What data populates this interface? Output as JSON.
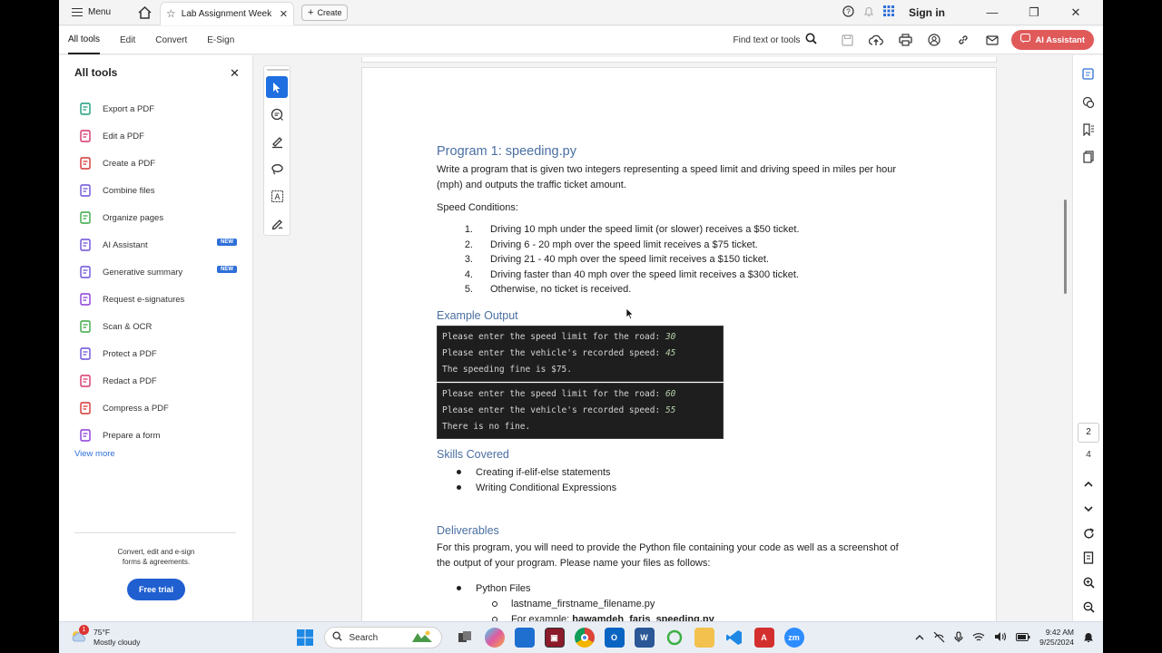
{
  "titlebar": {
    "menu_label": "Menu",
    "tab_title": "Lab Assignment Week 0...",
    "create_label": "Create",
    "sign_in": "Sign in"
  },
  "toolbar": {
    "nav": [
      "All tools",
      "Edit",
      "Convert",
      "E-Sign"
    ],
    "find_label": "Find text or tools",
    "ai_assistant": "AI Assistant"
  },
  "left_panel": {
    "title": "All tools",
    "items": [
      {
        "label": "Export a PDF",
        "icon": "export-pdf-icon",
        "color": "#1a9c7b"
      },
      {
        "label": "Edit a PDF",
        "icon": "edit-pdf-icon",
        "color": "#d6336c"
      },
      {
        "label": "Create a PDF",
        "icon": "create-pdf-icon",
        "color": "#d63333"
      },
      {
        "label": "Combine files",
        "icon": "combine-files-icon",
        "color": "#6b4fd8"
      },
      {
        "label": "Organize pages",
        "icon": "organize-pages-icon",
        "color": "#39a845"
      },
      {
        "label": "AI Assistant",
        "icon": "ai-assistant-icon",
        "color": "#6b4fd8",
        "badge": "NEW"
      },
      {
        "label": "Generative summary",
        "icon": "generative-summary-icon",
        "color": "#6b4fd8",
        "badge": "NEW"
      },
      {
        "label": "Request e-signatures",
        "icon": "request-esignatures-icon",
        "color": "#8a3ad8"
      },
      {
        "label": "Scan & OCR",
        "icon": "scan-ocr-icon",
        "color": "#39a845"
      },
      {
        "label": "Protect a PDF",
        "icon": "protect-pdf-icon",
        "color": "#6b4fd8"
      },
      {
        "label": "Redact a PDF",
        "icon": "redact-pdf-icon",
        "color": "#d6336c"
      },
      {
        "label": "Compress a PDF",
        "icon": "compress-pdf-icon",
        "color": "#d63333"
      },
      {
        "label": "Prepare a form",
        "icon": "prepare-form-icon",
        "color": "#8a3ad8"
      }
    ],
    "view_more": "View more",
    "promo_line1": "Convert, edit and e-sign",
    "promo_line2": "forms & agreements.",
    "free_trial": "Free trial"
  },
  "document": {
    "program_title": "Program 1: speeding.py",
    "intro_line1": "Write a program that is given two integers representing a speed limit and driving speed in miles per hour",
    "intro_line2": "(mph) and outputs the traffic ticket amount.",
    "conditions_label": "Speed Conditions:",
    "conditions": [
      {
        "num": "1.",
        "text": "Driving 10 mph under the speed limit (or slower) receives a $50 ticket."
      },
      {
        "num": "2.",
        "text": "Driving 6 - 20 mph over the speed limit receives a $75 ticket."
      },
      {
        "num": "3.",
        "text": "Driving 21 - 40 mph over the speed limit receives a $150 ticket."
      },
      {
        "num": "4.",
        "text": "Driving faster than 40 mph over the speed limit receives a $300 ticket."
      },
      {
        "num": "5.",
        "text": "Otherwise, no ticket is received."
      }
    ],
    "example_heading": "Example Output",
    "example1": [
      {
        "text": "Please enter the speed limit for the road: ",
        "val": "30"
      },
      {
        "text": "Please enter the vehicle's recorded speed: ",
        "val": "45"
      },
      {
        "text": "The speeding fine is $75.",
        "val": ""
      }
    ],
    "example2": [
      {
        "text": "Please enter the speed limit for the road: ",
        "val": "60"
      },
      {
        "text": "Please enter the vehicle's recorded speed: ",
        "val": "55"
      },
      {
        "text": "There is no fine.",
        "val": ""
      }
    ],
    "skills_heading": "Skills Covered",
    "skills": [
      "Creating if-elif-else statements",
      "Writing Conditional Expressions"
    ],
    "deliverables_heading": "Deliverables",
    "deliverables_line1": "For this program, you will need to provide the Python file containing your code as well as a screenshot of",
    "deliverables_line2": "the output of your program. Please name your files as follows:",
    "python_files": "Python Files",
    "file_pattern": "lastname_firstname_filename.py",
    "example_prefix": "For example: ",
    "example_file": "hawamdeh_faris_speeding.py"
  },
  "right_rail": {
    "current_page": "2",
    "total_pages": "4"
  },
  "taskbar": {
    "weather_temp": "75°F",
    "weather_desc": "Mostly cloudy",
    "weather_badge": "1",
    "search_label": "Search",
    "time": "9:42 AM",
    "date": "9/25/2024"
  }
}
